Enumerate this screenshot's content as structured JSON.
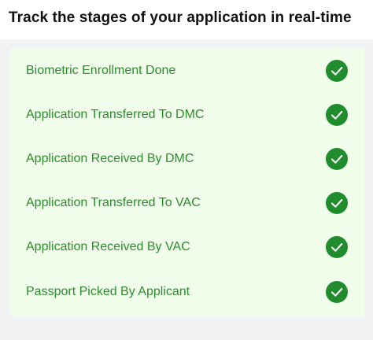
{
  "header": {
    "title": "Track the stages of your application in real-time"
  },
  "stages": [
    {
      "label": "Biometric Enrollment Done",
      "status": "completed",
      "icon": "check-circle-icon"
    },
    {
      "label": "Application Transferred To DMC",
      "status": "completed",
      "icon": "check-circle-icon"
    },
    {
      "label": "Application Received By DMC",
      "status": "completed",
      "icon": "check-circle-icon"
    },
    {
      "label": "Application Transferred To VAC",
      "status": "completed",
      "icon": "check-circle-icon"
    },
    {
      "label": "Application Received By VAC",
      "status": "completed",
      "icon": "check-circle-icon"
    },
    {
      "label": "Passport Picked By Applicant",
      "status": "completed",
      "icon": "check-circle-icon"
    }
  ],
  "colors": {
    "label_text": "#2e8b2e",
    "check_fill": "#218c2e",
    "card_background": "#f0fdea"
  }
}
